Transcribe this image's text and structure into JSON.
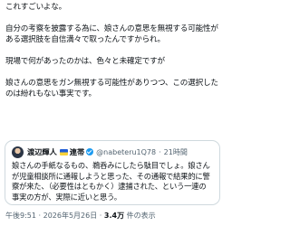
{
  "post": {
    "paragraphs": [
      "これすごいよな。",
      "自分の考察を披露する為に、娘さんの意思を無視する可能性がある選択肢を自信満々で取ったんですかられ。",
      "現場で何があったのかは、色々と未確定ですが",
      "娘さんの意思をガン無視する可能性がありつつ、この選択したのは紛れもない事実です。"
    ]
  },
  "quote": {
    "name": "渡辺輝人",
    "party": "連帯",
    "handle": "@nabeteru1Q78",
    "time": "21時間",
    "text": "娘さんの手紙なるもの、鵜呑みにしたら駄目でしょ。娘さんが児童相談所に通報しようと思った、その通報で結果的に警察が来た、（必要性はともかく）逮捕された、という一連の事実の方が、実際に近いと思う。"
  },
  "meta": {
    "time": "午後9:51",
    "date": "2026年5月26日",
    "views_count": "3.4万",
    "views_label": "件の表示"
  }
}
